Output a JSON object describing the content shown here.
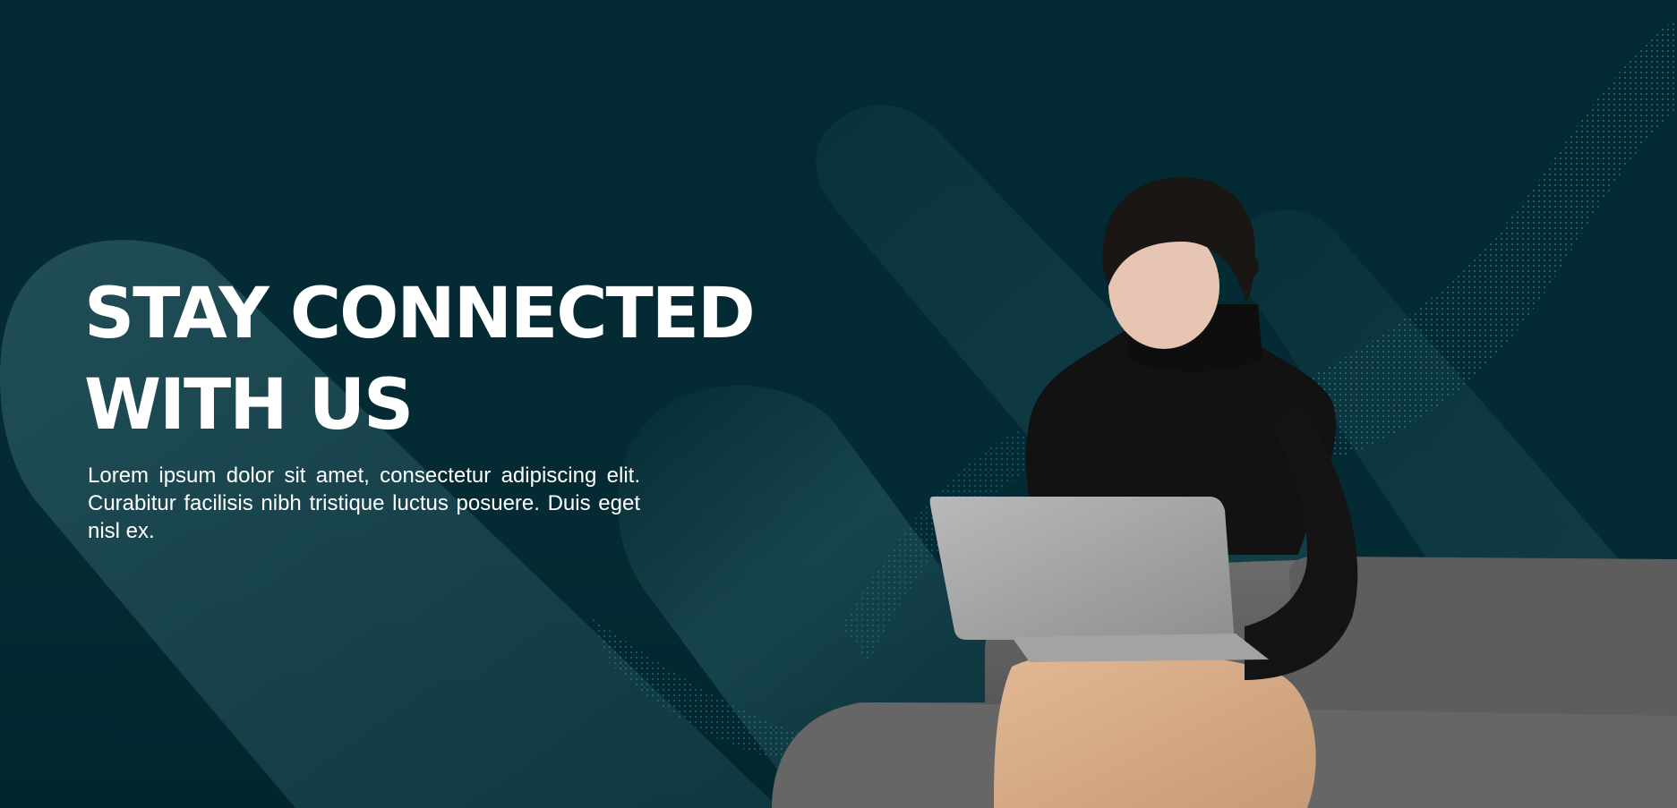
{
  "hero": {
    "headline_line1": "STAY CONNECTED",
    "headline_line2": "WITH US",
    "body": "Lorem ipsum dolor sit amet, consectetur adipiscing elit. Curabitur facilisis nibh tristique luctus posuere. Duis eget nisl ex."
  },
  "theme": {
    "background": "#032a33",
    "shape": "#1b4750",
    "accent_dots": "#2a8f98",
    "text": "#ffffff"
  }
}
